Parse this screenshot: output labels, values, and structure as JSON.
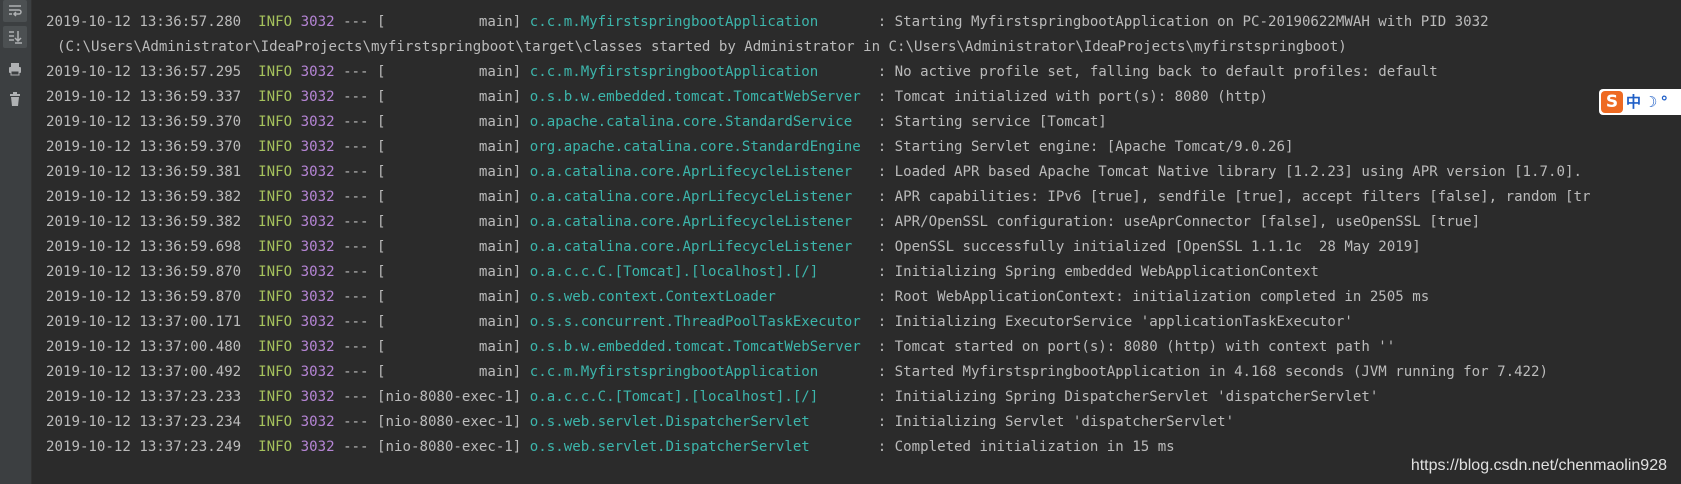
{
  "toolbar": {
    "buttons": [
      {
        "name": "soft-wrap-icon",
        "glyph": "⤶"
      },
      {
        "name": "scroll-to-end-icon",
        "glyph": "⤓"
      },
      {
        "name": "print-icon",
        "glyph": "⎙"
      },
      {
        "name": "clear-all-icon",
        "glyph": "🗑"
      }
    ]
  },
  "colors": {
    "background": "#2b2b2b",
    "timestamp": "#bbbbbb",
    "level_info": "#a5c25c",
    "pid": "#b685d6",
    "logger": "#3cb5ab",
    "message": "#bbbbbb"
  },
  "log": [
    {
      "ts": "2019-10-12 13:36:57.280",
      "level": "INFO",
      "pid": "3032",
      "sep": "---",
      "thread": "[           main]",
      "logger": "c.c.m.MyfirstspringbootApplication      ",
      "msg": ": Starting MyfirstspringbootApplication on PC-20190622MWAH with PID 3032"
    },
    {
      "wrap": "(C:\\Users\\Administrator\\IdeaProjects\\myfirstspringboot\\target\\classes started by Administrator in C:\\Users\\Administrator\\IdeaProjects\\myfirstspringboot)"
    },
    {
      "ts": "2019-10-12 13:36:57.295",
      "level": "INFO",
      "pid": "3032",
      "sep": "---",
      "thread": "[           main]",
      "logger": "c.c.m.MyfirstspringbootApplication      ",
      "msg": ": No active profile set, falling back to default profiles: default"
    },
    {
      "ts": "2019-10-12 13:36:59.337",
      "level": "INFO",
      "pid": "3032",
      "sep": "---",
      "thread": "[           main]",
      "logger": "o.s.b.w.embedded.tomcat.TomcatWebServer ",
      "msg": ": Tomcat initialized with port(s): 8080 (http)"
    },
    {
      "ts": "2019-10-12 13:36:59.370",
      "level": "INFO",
      "pid": "3032",
      "sep": "---",
      "thread": "[           main]",
      "logger": "o.apache.catalina.core.StandardService  ",
      "msg": ": Starting service [Tomcat]"
    },
    {
      "ts": "2019-10-12 13:36:59.370",
      "level": "INFO",
      "pid": "3032",
      "sep": "---",
      "thread": "[           main]",
      "logger": "org.apache.catalina.core.StandardEngine ",
      "msg": ": Starting Servlet engine: [Apache Tomcat/9.0.26]"
    },
    {
      "ts": "2019-10-12 13:36:59.381",
      "level": "INFO",
      "pid": "3032",
      "sep": "---",
      "thread": "[           main]",
      "logger": "o.a.catalina.core.AprLifecycleListener  ",
      "msg": ": Loaded APR based Apache Tomcat Native library [1.2.23] using APR version [1.7.0]."
    },
    {
      "ts": "2019-10-12 13:36:59.382",
      "level": "INFO",
      "pid": "3032",
      "sep": "---",
      "thread": "[           main]",
      "logger": "o.a.catalina.core.AprLifecycleListener  ",
      "msg": ": APR capabilities: IPv6 [true], sendfile [true], accept filters [false], random [tr"
    },
    {
      "ts": "2019-10-12 13:36:59.382",
      "level": "INFO",
      "pid": "3032",
      "sep": "---",
      "thread": "[           main]",
      "logger": "o.a.catalina.core.AprLifecycleListener  ",
      "msg": ": APR/OpenSSL configuration: useAprConnector [false], useOpenSSL [true]"
    },
    {
      "ts": "2019-10-12 13:36:59.698",
      "level": "INFO",
      "pid": "3032",
      "sep": "---",
      "thread": "[           main]",
      "logger": "o.a.catalina.core.AprLifecycleListener  ",
      "msg": ": OpenSSL successfully initialized [OpenSSL 1.1.1c  28 May 2019]"
    },
    {
      "ts": "2019-10-12 13:36:59.870",
      "level": "INFO",
      "pid": "3032",
      "sep": "---",
      "thread": "[           main]",
      "logger": "o.a.c.c.C.[Tomcat].[localhost].[/]      ",
      "msg": ": Initializing Spring embedded WebApplicationContext"
    },
    {
      "ts": "2019-10-12 13:36:59.870",
      "level": "INFO",
      "pid": "3032",
      "sep": "---",
      "thread": "[           main]",
      "logger": "o.s.web.context.ContextLoader           ",
      "msg": ": Root WebApplicationContext: initialization completed in 2505 ms"
    },
    {
      "ts": "2019-10-12 13:37:00.171",
      "level": "INFO",
      "pid": "3032",
      "sep": "---",
      "thread": "[           main]",
      "logger": "o.s.s.concurrent.ThreadPoolTaskExecutor ",
      "msg": ": Initializing ExecutorService 'applicationTaskExecutor'"
    },
    {
      "ts": "2019-10-12 13:37:00.480",
      "level": "INFO",
      "pid": "3032",
      "sep": "---",
      "thread": "[           main]",
      "logger": "o.s.b.w.embedded.tomcat.TomcatWebServer ",
      "msg": ": Tomcat started on port(s): 8080 (http) with context path ''"
    },
    {
      "ts": "2019-10-12 13:37:00.492",
      "level": "INFO",
      "pid": "3032",
      "sep": "---",
      "thread": "[           main]",
      "logger": "c.c.m.MyfirstspringbootApplication      ",
      "msg": ": Started MyfirstspringbootApplication in 4.168 seconds (JVM running for 7.422)"
    },
    {
      "ts": "2019-10-12 13:37:23.233",
      "level": "INFO",
      "pid": "3032",
      "sep": "---",
      "thread": "[nio-8080-exec-1]",
      "logger": "o.a.c.c.C.[Tomcat].[localhost].[/]      ",
      "msg": ": Initializing Spring DispatcherServlet 'dispatcherServlet'"
    },
    {
      "ts": "2019-10-12 13:37:23.234",
      "level": "INFO",
      "pid": "3032",
      "sep": "---",
      "thread": "[nio-8080-exec-1]",
      "logger": "o.s.web.servlet.DispatcherServlet       ",
      "msg": ": Initializing Servlet 'dispatcherServlet'"
    },
    {
      "ts": "2019-10-12 13:37:23.249",
      "level": "INFO",
      "pid": "3032",
      "sep": "---",
      "thread": "[nio-8080-exec-1]",
      "logger": "o.s.web.servlet.DispatcherServlet       ",
      "msg": ": Completed initialization in 15 ms"
    }
  ],
  "ime": {
    "logo": "S",
    "items": [
      "中",
      "☽",
      "°"
    ]
  },
  "watermark": "https://blog.csdn.net/chenmaolin928"
}
